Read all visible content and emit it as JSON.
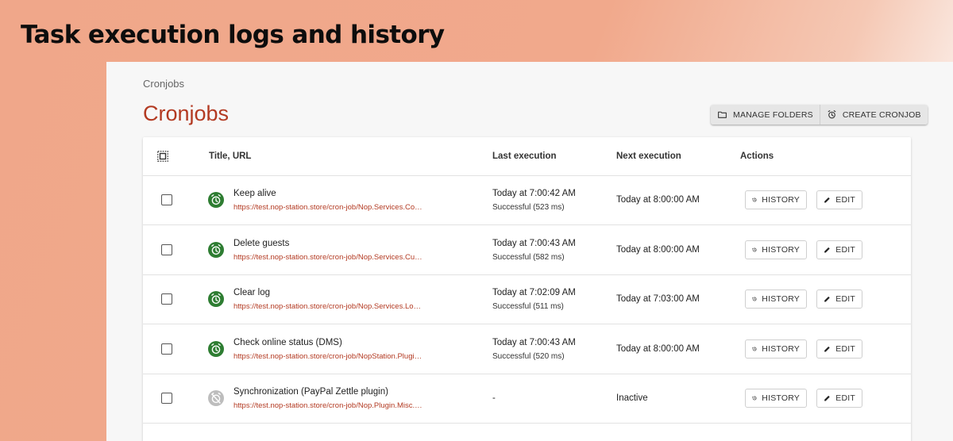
{
  "banner": {
    "title": "Task execution logs and history"
  },
  "breadcrumb": "Cronjobs",
  "page_title": "Cronjobs",
  "toolbar": {
    "manage_folders_label": "MANAGE FOLDERS",
    "create_cronjob_label": "CREATE CRONJOB"
  },
  "table": {
    "columns": [
      "Title, URL",
      "Last execution",
      "Next execution",
      "Actions"
    ],
    "history_label": "HISTORY",
    "edit_label": "EDIT",
    "rows": [
      {
        "status": "active",
        "title": "Keep alive",
        "url": "https://test.nop-station.store/cron-job/Nop.Services.Common.KeepAliveTask",
        "last_execution": "Today at 7:00:42 AM",
        "last_result": "Successful (523 ms)",
        "next_execution": "Today at 8:00:00 AM"
      },
      {
        "status": "active",
        "title": "Delete guests",
        "url": "https://test.nop-station.store/cron-job/Nop.Services.Customers.DeleteGuestsTask",
        "last_execution": "Today at 7:00:43 AM",
        "last_result": "Successful (582 ms)",
        "next_execution": "Today at 8:00:00 AM"
      },
      {
        "status": "active",
        "title": "Clear log",
        "url": "https://test.nop-station.store/cron-job/Nop.Services.Logging.ClearLogTask",
        "last_execution": "Today at 7:02:09 AM",
        "last_result": "Successful (511 ms)",
        "next_execution": "Today at 7:03:00 AM"
      },
      {
        "status": "active",
        "title": "Check online status (DMS)",
        "url": "https://test.nop-station.store/cron-job/NopStation.Plugin.DMS.CheckOnlineStatusTask",
        "last_execution": "Today at 7:00:43 AM",
        "last_result": "Successful (520 ms)",
        "next_execution": "Today at 8:00:00 AM"
      },
      {
        "status": "inactive",
        "title": "Synchronization (PayPal Zettle plugin)",
        "url": "https://test.nop-station.store/cron-job/Nop.Plugin.Misc.Zettle.SynchronizationTask",
        "last_execution": "-",
        "last_result": "",
        "next_execution": "Inactive"
      }
    ]
  },
  "colors": {
    "accent": "#b33a22",
    "success": "#2e7d32",
    "inactive": "#bdbdbd",
    "banner_bg": "#f1a98c"
  },
  "icons": {
    "select_all": "select-all-icon",
    "folder": "folder-icon",
    "alarm": "alarm-clock-icon",
    "history": "history-icon",
    "edit": "pencil-icon",
    "inactive": "alarm-off-icon"
  }
}
